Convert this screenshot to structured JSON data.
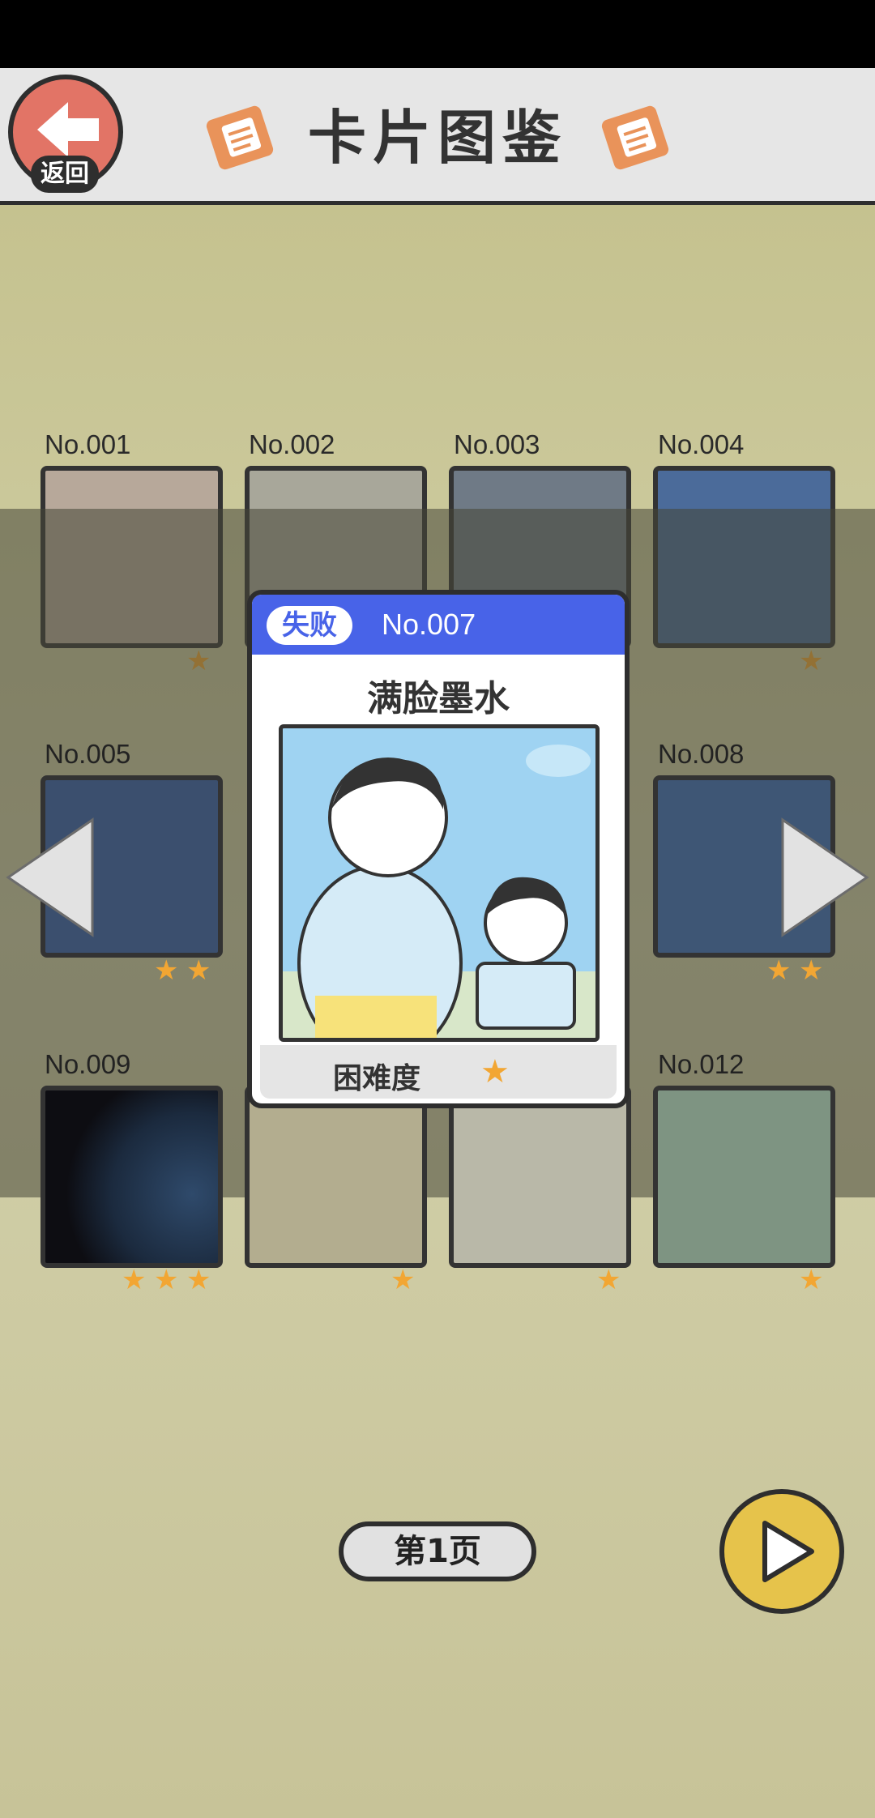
{
  "header": {
    "back_label": "返回",
    "title": "卡片图鉴"
  },
  "cards": [
    {
      "label": "No.001",
      "stars": 1
    },
    {
      "label": "No.002",
      "stars": 0
    },
    {
      "label": "No.003",
      "stars": 0
    },
    {
      "label": "No.004",
      "stars": 1
    },
    {
      "label": "No.005",
      "stars": 2
    },
    {
      "label": "No.008",
      "stars": 2
    },
    {
      "label": "No.009",
      "stars": 3
    },
    {
      "label": "",
      "stars": 1
    },
    {
      "label": "",
      "stars": 1
    },
    {
      "label": "No.012",
      "stars": 1
    }
  ],
  "popup": {
    "status_badge": "失败",
    "number": "No.007",
    "title": "满脸墨水",
    "difficulty_label": "困难度",
    "difficulty_stars": 1
  },
  "footer": {
    "page_label": "第1页"
  },
  "colors": {
    "accent_blue": "#4863e8",
    "star": "#f2a633",
    "back_button": "#e27466",
    "next_button": "#e6c34b"
  },
  "icons": [
    "back-arrow-icon",
    "document-icon",
    "left-arrow-icon",
    "right-arrow-icon",
    "play-icon",
    "star-icon"
  ]
}
